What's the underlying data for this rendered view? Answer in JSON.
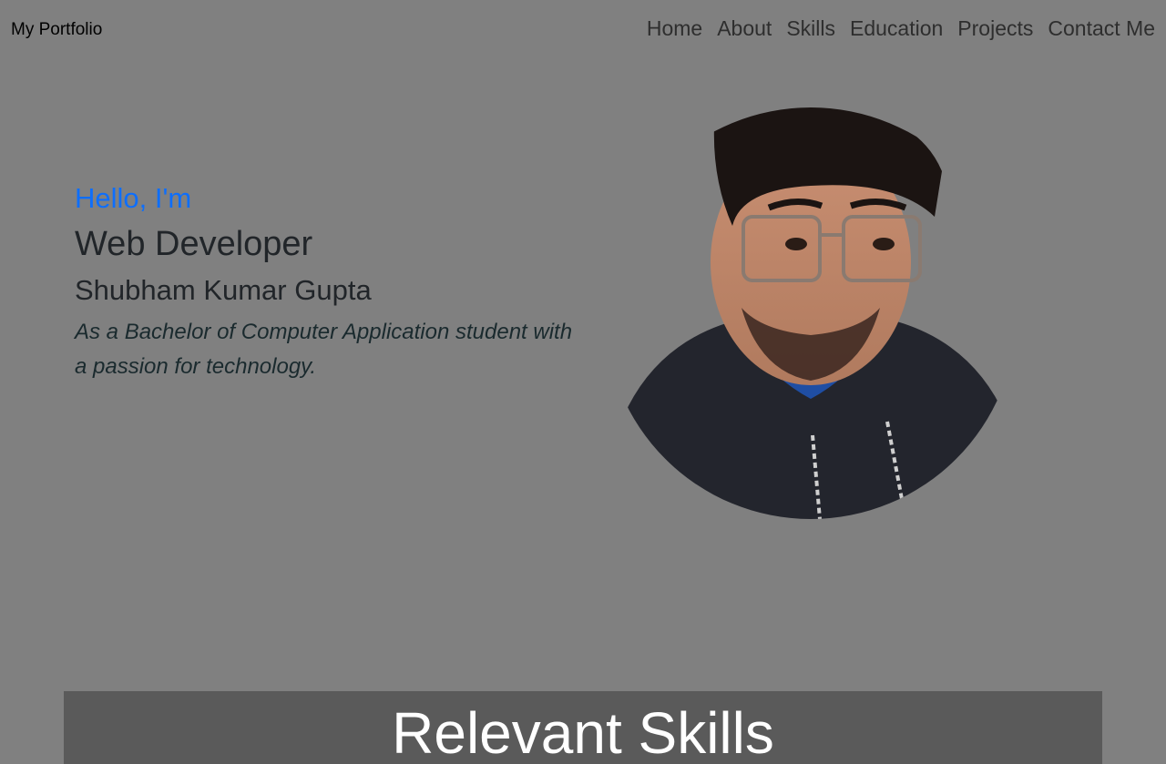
{
  "nav": {
    "brand": "My Portfolio",
    "links": [
      "Home",
      "About",
      "Skills",
      "Education",
      "Projects",
      "Contact Me"
    ]
  },
  "hero": {
    "greeting": "Hello, I'm",
    "role": "Web Developer",
    "name": "Shubham Kumar Gupta",
    "tagline": "As a Bachelor of Computer Application student with a passion for technology."
  },
  "skills": {
    "title": "Relevant Skills"
  },
  "colors": {
    "background": "#808080",
    "accent": "#0d6efd",
    "banner": "#5a5a5a"
  }
}
